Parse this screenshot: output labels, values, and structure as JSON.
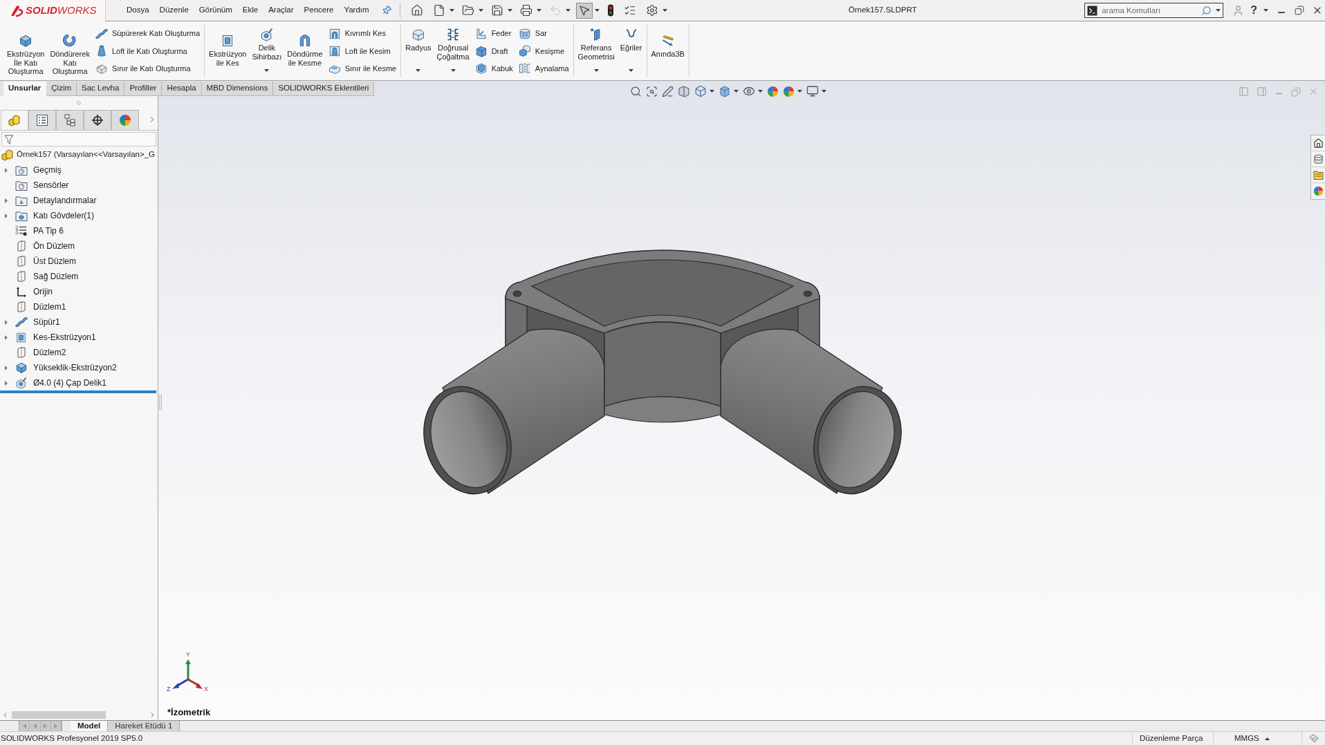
{
  "logo": "**SOLID**WORKS",
  "menu": [
    "Dosya",
    "Düzenle",
    "Görünüm",
    "Ekle",
    "Araçlar",
    "Pencere",
    "Yardım"
  ],
  "quick_access": [
    {
      "kind": "home",
      "dropdown": false,
      "disabled": false,
      "pressed": false
    },
    {
      "kind": "new",
      "dropdown": true,
      "disabled": false,
      "pressed": false
    },
    {
      "kind": "open",
      "dropdown": true,
      "disabled": false,
      "pressed": false
    },
    {
      "kind": "save",
      "dropdown": true,
      "disabled": false,
      "pressed": false
    },
    {
      "kind": "print",
      "dropdown": true,
      "disabled": false,
      "pressed": false
    },
    {
      "kind": "undo",
      "dropdown": true,
      "disabled": true,
      "pressed": false
    },
    {
      "kind": "select",
      "dropdown": true,
      "disabled": false,
      "pressed": true
    },
    {
      "kind": "rebuild",
      "dropdown": false,
      "disabled": false,
      "pressed": false
    },
    {
      "kind": "file_properties",
      "dropdown": false,
      "disabled": false,
      "pressed": false
    },
    {
      "kind": "options",
      "dropdown": true,
      "disabled": false,
      "pressed": false
    }
  ],
  "document_title": "Örnek157.SLDPRT",
  "search": {
    "placeholder": "arama Komutları"
  },
  "help": "?",
  "ribbon": [
    {
      "columns": [
        {
          "kind": "large",
          "label": "Ekstrüzyon\nİle Katı\nOluşturma",
          "dropdown": false
        },
        {
          "kind": "large",
          "label": "Döndürerek\nKatı\nOluşturma",
          "dropdown": false
        },
        {
          "kind": "stack",
          "items": [
            "Süpürerek Katı Oluşturma",
            "Loft ile Katı Oluşturma",
            "Sınır ile Katı Oluşturma"
          ]
        }
      ]
    },
    {
      "columns": [
        {
          "kind": "large",
          "label": "Ekstrüzyon\nile Kes",
          "dropdown": false
        },
        {
          "kind": "large",
          "label": "Delik\nSihirbazı",
          "dropdown": true
        },
        {
          "kind": "large",
          "label": "Döndürme\nile Kesme",
          "dropdown": false
        },
        {
          "kind": "stack",
          "items": [
            "Kıvrımlı Kes",
            "Loft ile Kesim",
            "Sınır ile Kesme"
          ]
        }
      ]
    },
    {
      "columns": [
        {
          "kind": "large",
          "label": "Radyus",
          "dropdown": true
        },
        {
          "kind": "large",
          "label": "Doğrusal\nÇoğaltma",
          "dropdown": true
        },
        {
          "kind": "stack",
          "items": [
            "Feder",
            "Draft",
            "Kabuk"
          ]
        },
        {
          "kind": "stack",
          "items": [
            "Sar",
            "Kesişme",
            "Aynalama"
          ]
        }
      ]
    },
    {
      "columns": [
        {
          "kind": "large",
          "label": "Referans\nGeometrisi",
          "dropdown": true
        },
        {
          "kind": "large",
          "label": "Eğriler",
          "dropdown": true
        }
      ]
    },
    {
      "columns": [
        {
          "kind": "large",
          "label": "Anında3B",
          "dropdown": false
        }
      ]
    }
  ],
  "command_tabs": [
    {
      "label": "Unsurlar",
      "selected": true
    },
    {
      "label": "Çizim",
      "selected": false
    },
    {
      "label": "Sac Levha",
      "selected": false
    },
    {
      "label": "Profiller",
      "selected": false
    },
    {
      "label": "Hesapla",
      "selected": false
    },
    {
      "label": "MBD Dimensions",
      "selected": false
    },
    {
      "label": "SOLIDWORKS Eklentileri",
      "selected": false
    }
  ],
  "panel_tabs": [
    {
      "kind": "feature_manager",
      "selected": true
    },
    {
      "kind": "property_manager",
      "selected": false
    },
    {
      "kind": "configuration_manager",
      "selected": false
    },
    {
      "kind": "dimxpert_manager",
      "selected": false
    },
    {
      "kind": "display_manager",
      "selected": false
    }
  ],
  "feature_tree": {
    "label": "Örnek157 (Varsayılan<<Varsayılan>_G",
    "children": [
      {
        "label": "Geçmiş",
        "kind": "history_folder",
        "expandable": true
      },
      {
        "label": "Sensörler",
        "kind": "sensor_folder",
        "expandable": false
      },
      {
        "label": "Detaylandırmalar",
        "kind": "annotation_folder",
        "expandable": true
      },
      {
        "label": "Katı Gövdeler(1)",
        "kind": "body_folder",
        "expandable": true
      },
      {
        "label": "PA Tip 6",
        "kind": "material",
        "expandable": false
      },
      {
        "label": "Ön Düzlem",
        "kind": "plane",
        "expandable": false
      },
      {
        "label": "Üst Düzlem",
        "kind": "plane",
        "expandable": false
      },
      {
        "label": "Sağ Düzlem",
        "kind": "plane",
        "expandable": false
      },
      {
        "label": "Orijin",
        "kind": "origin",
        "expandable": false
      },
      {
        "label": "Düzlem1",
        "kind": "plane",
        "expandable": false
      },
      {
        "label": "Süpür1",
        "kind": "sweep",
        "expandable": true
      },
      {
        "label": "Kes-Ekstrüzyon1",
        "kind": "cut",
        "expandable": true
      },
      {
        "label": "Düzlem2",
        "kind": "plane",
        "expandable": false
      },
      {
        "label": "Yükseklik-Ekstrüzyon2",
        "kind": "boss",
        "expandable": true
      },
      {
        "label": "Ø4.0 (4) Çap Delik1",
        "kind": "hole",
        "expandable": true
      }
    ]
  },
  "viewport": {
    "view_label": "*İzometrik",
    "triad": {
      "x": "X",
      "y": "Y",
      "z": "Z"
    }
  },
  "model_tabs": [
    {
      "label": "Model",
      "selected": true
    },
    {
      "label": "Hareket Etüdü 1",
      "selected": false
    }
  ],
  "status_bar": {
    "product": "SOLIDWORKS Profesyonel 2019 SP5.0",
    "mode": "Düzenleme Parça",
    "units": "MMGS"
  }
}
